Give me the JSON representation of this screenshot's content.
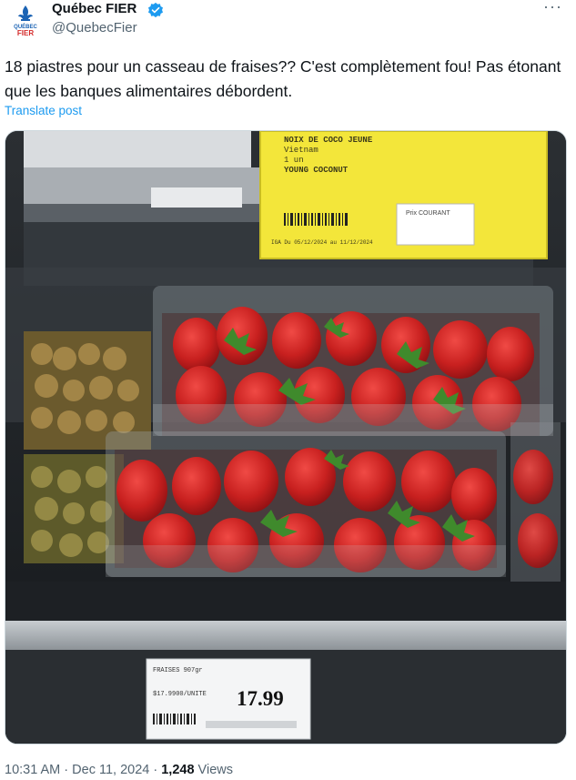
{
  "author": {
    "display_name": "Québec FIER",
    "handle": "@QuebecFier",
    "avatar_icon": "fleur-de-lis-logo",
    "logo_text_top": "QUÉBEC",
    "logo_text_bottom": "FIER",
    "verified_icon": "verified-badge-icon",
    "verified_color": "#1d9bf0"
  },
  "more_icon": "more-options-icon",
  "tweet": {
    "text": "18 piastres pour un casseau de fraises?? C'est complètement fou! Pas étonant que les banques alimentaires débordent.",
    "translate_label": "Translate post"
  },
  "photo": {
    "top_sign": {
      "line1": "NOIX DE COCO JEUNE",
      "line2": "Vietnam",
      "line3": "1 un",
      "line4": "YOUNG COCONUT",
      "price_box": "Prix COURANT",
      "dates": "IGA Du 05/12/2024 au 11/12/2024"
    },
    "shelf_label": {
      "product": "FRAISES 907gr",
      "unit_price": "$17.9900/UNITE",
      "price": "17.99"
    }
  },
  "meta": {
    "time": "10:31 AM",
    "separator": " · ",
    "date": "Dec 11, 2024",
    "views_count": "1,248",
    "views_label": " Views"
  }
}
